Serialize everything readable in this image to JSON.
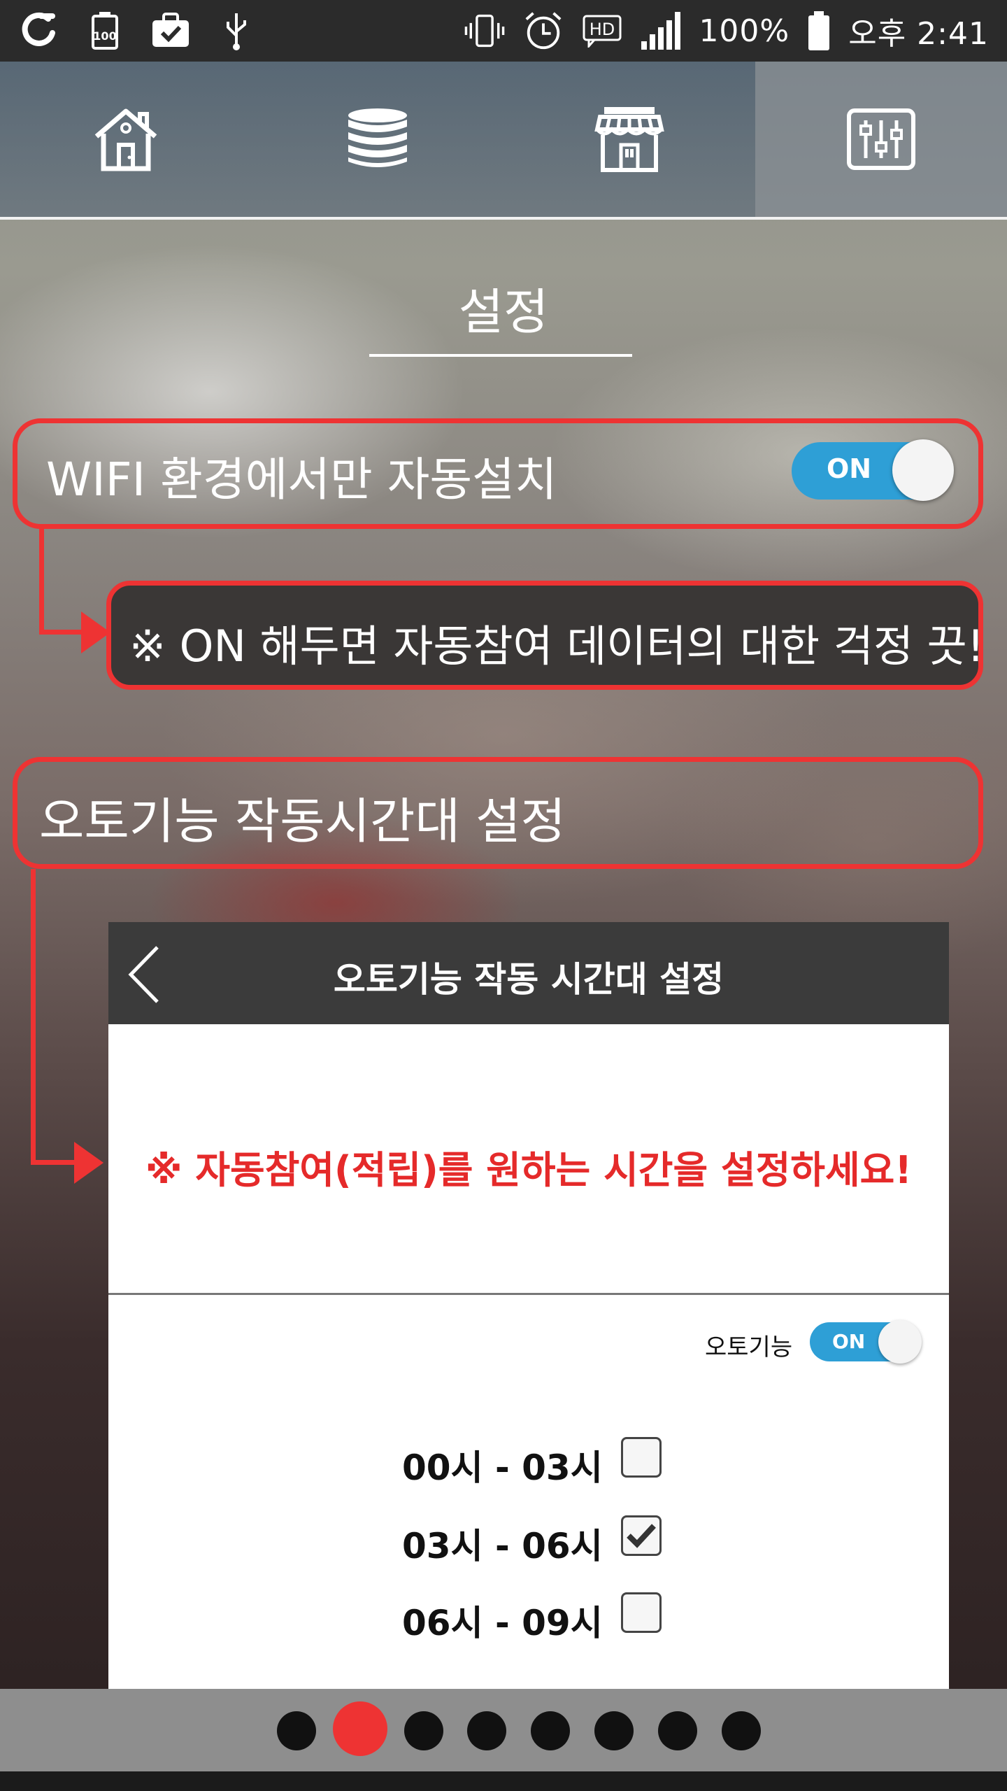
{
  "status_bar": {
    "battery_percent": "100%",
    "time": "오후 2:41",
    "icons": [
      "o-logo-icon",
      "battery-100-icon",
      "briefcase-check-icon",
      "usb-icon",
      "vibrate-icon",
      "alarm-icon",
      "hd-icon",
      "signal-icon",
      "battery-icon"
    ]
  },
  "tabs": [
    {
      "name": "home-icon",
      "active": false
    },
    {
      "name": "coins-icon",
      "active": false
    },
    {
      "name": "store-icon",
      "active": false
    },
    {
      "name": "settings-sliders-icon",
      "active": true
    }
  ],
  "page_title": "설정",
  "wifi_setting": {
    "label": "WIFI 환경에서만 자동설치",
    "toggle": "ON"
  },
  "wifi_note": "※ ON 해두면 자동참여 데이터의 대한 걱정 끗!",
  "auto_time_callout": "오토기능 작동시간대 설정",
  "panel": {
    "header_title": "오토기능 작동 시간대 설정",
    "message": "※ 자동참여(적립)를 원하는 시간을 설정하세요!",
    "auto_label": "오토기능",
    "auto_toggle": "ON",
    "time_slots": [
      {
        "label": "00시 - 03시",
        "checked": false
      },
      {
        "label": "03시 - 06시",
        "checked": true
      },
      {
        "label": "06시 - 09시",
        "checked": false
      }
    ]
  },
  "pager": {
    "count": 8,
    "active_index": 1
  },
  "colors": {
    "accent_red": "#ee3333",
    "toggle_blue": "#2e9fd6",
    "message_red": "#e52a2a"
  }
}
